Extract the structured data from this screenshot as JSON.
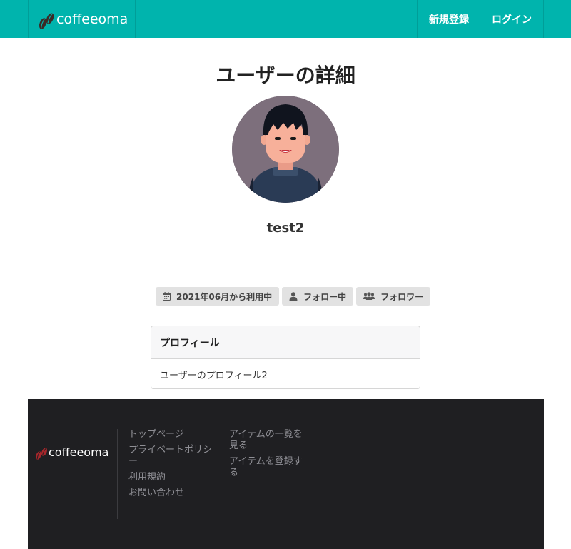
{
  "header": {
    "brand": "coffeeoma",
    "nav": [
      "新規登録",
      "ログイン"
    ]
  },
  "main": {
    "title": "ユーザーの詳細",
    "username": "test2",
    "badges": {
      "since": "2021年06月から利用中",
      "following": "フォロー中",
      "followers": "フォロワー"
    },
    "profile": {
      "heading": "プロフィール",
      "text": "ユーザーのプロフィール2"
    }
  },
  "footer": {
    "brand": "coffeeoma",
    "col1": [
      "トップページ",
      "プライベートポリシー",
      "利用規約",
      "お問い合わせ"
    ],
    "col2": [
      "アイテムの一覧を見る",
      "アイテムを登録する"
    ]
  },
  "colors": {
    "navbar": "#00b4ad",
    "footer": "#1f1f22",
    "badge": "#e2e2e2",
    "bean_dark": "#3a2a26",
    "bean_red": "#a8262b"
  },
  "icons": [
    "coffee-beans-icon",
    "calendar-icon",
    "user-icon",
    "users-icon"
  ]
}
